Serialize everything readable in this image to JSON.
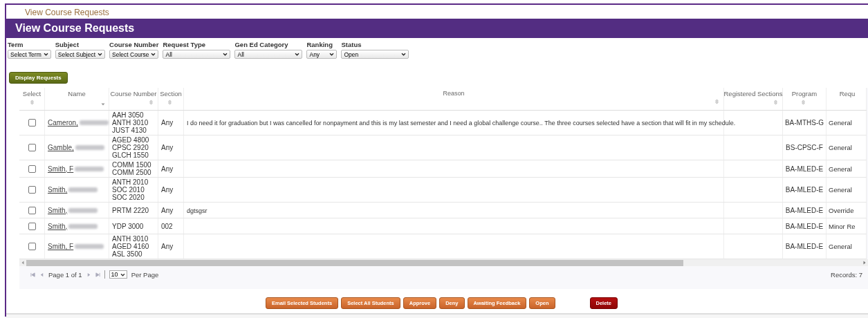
{
  "breadcrumb": "View Course Requests",
  "header": {
    "title": "View Course Requests"
  },
  "filters": [
    {
      "label": "Term",
      "value": "Select Term"
    },
    {
      "label": "Subject",
      "value": "Select Subject"
    },
    {
      "label": "Course Number",
      "value": "Select Course"
    },
    {
      "label": "Request Type",
      "value": "All"
    },
    {
      "label": "Gen Ed Category",
      "value": "All"
    },
    {
      "label": "Ranking",
      "value": "Any"
    },
    {
      "label": "Status",
      "value": "Open"
    }
  ],
  "display_button": "Display Requests",
  "table": {
    "columns": [
      "Select",
      "Name",
      "Course Number",
      "Section",
      "Reason",
      "Registered Sections",
      "Program",
      "Requ"
    ],
    "rows": [
      {
        "checked": false,
        "name": "Cameron,",
        "courses": [
          "AAH 3050",
          "ANTH 3010",
          "JUST 4130"
        ],
        "section": "Any",
        "reason": "I do need it for graduation but I was cancelled for nonpayment and this is my last semester and I need a global challenge course.. The three courses selected have a section that will fit in my schedule.",
        "registered_sections": "",
        "program": "BA-MTHS-G",
        "column_8": "General"
      },
      {
        "checked": false,
        "name": "Gamble,",
        "courses": [
          "AGED 4800",
          "CPSC 2920",
          "GLCH 1550"
        ],
        "section": "Any",
        "reason": "",
        "registered_sections": "",
        "program": "BS-CPSC-F",
        "column_8": "General"
      },
      {
        "checked": false,
        "name": "Smith, F",
        "courses": [
          "COMM 1500",
          "COMM 2500"
        ],
        "section": "Any",
        "reason": "",
        "registered_sections": "",
        "program": "BA-MLED-E",
        "column_8": "General"
      },
      {
        "checked": false,
        "name": "Smith,",
        "courses": [
          "ANTH 2010",
          "SOC 2010",
          "SOC 2020"
        ],
        "section": "Any",
        "reason": "",
        "registered_sections": "",
        "program": "BA-MLED-E",
        "column_8": "General"
      },
      {
        "checked": false,
        "name": "Smith,",
        "courses": [
          "PRTM 2220"
        ],
        "section": "Any",
        "reason": "dgtsgsr",
        "registered_sections": "",
        "program": "BA-MLED-E",
        "column_8": "Override"
      },
      {
        "checked": false,
        "name": "Smith,",
        "courses": [
          "YDP 3000"
        ],
        "section": "002",
        "reason": "",
        "registered_sections": "",
        "program": "BA-MLED-E",
        "column_8": "Minor Re"
      },
      {
        "checked": false,
        "name": "Smith, F",
        "courses": [
          "ANTH 3010",
          "AGED 4160",
          "ASL 3500"
        ],
        "section": "Any",
        "reason": "",
        "registered_sections": "",
        "program": "BA-MLED-E",
        "column_8": "General"
      }
    ]
  },
  "pager": {
    "page_text": "Page 1 of 1",
    "per_page_value": "10",
    "per_page_label": "Per Page",
    "records": "Records: 7"
  },
  "actions": [
    {
      "label": "Email Selected Students",
      "kind": "action"
    },
    {
      "label": "Select All Students",
      "kind": "action"
    },
    {
      "label": "Approve",
      "kind": "action"
    },
    {
      "label": "Deny",
      "kind": "action"
    },
    {
      "label": "Awaiting Feedback",
      "kind": "action"
    },
    {
      "label": "Open",
      "kind": "action"
    },
    {
      "label": "Delete",
      "kind": "danger"
    }
  ]
}
